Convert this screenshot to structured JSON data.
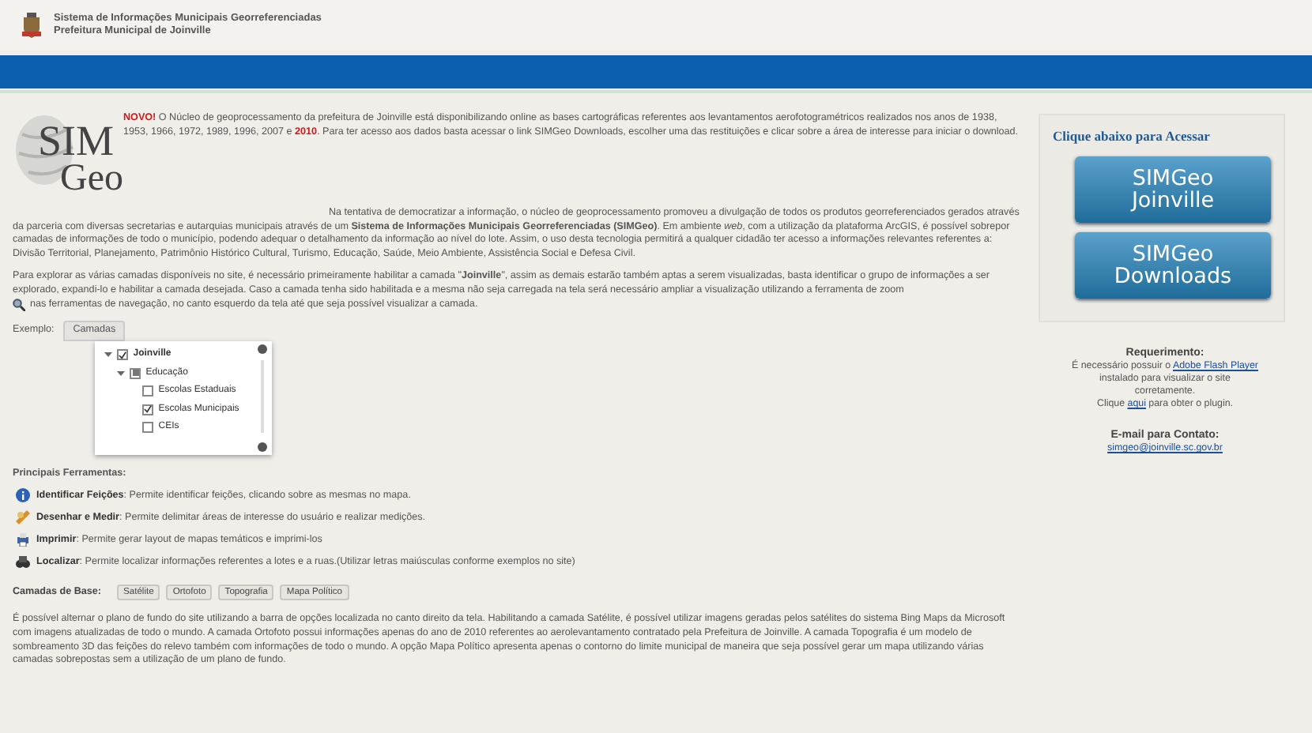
{
  "header": {
    "title": "Sistema de Informações Municipais Georreferenciadas",
    "subtitle": "Prefeitura Municipal de Joinville"
  },
  "logo": {
    "line1": "SIM",
    "line2": "Geo"
  },
  "intro": "**NOVO!** O Núcleo de geoprocessamento da prefeitura de Joinville está disponibilizando online as bases cartográficas referentes aos levantamentos aerofotogramétricos realizados nos anos de 1938, 1953, 1966, 1972, 1989, 1996, 2007 e **2010**. Para ter acesso aos dados basta acessar o link SIMGeo Downloads, escolher uma das restituições e clicar sobre a área de interesse para iniciar o download.",
  "paragraph": "Na tentativa de democratizar a informação, o núcleo de geoprocessamento promoveu a divulgação de todos os produtos georreferenciados gerados através da parceria com diversas secretarias e autarquias municipais através de um **Sistema de Informações Municipais Georreferenciadas (SIMGeo)**. Em ambiente *web*, com a utilização da plataforma ArcGIS, é possível sobrepor camadas de informações de todo o município, podendo adequar o detalhamento da informação ao nível do lote. Assim, o uso desta tecnologia permitirá a qualquer cidadão ter acesso a informações relevantes referentes a: Divisão Territorial, Planejamento, Patrimônio Histórico Cultural, Turismo, Educação, Saúde, Meio Ambiente, Assistência Social e Defesa Civil.",
  "explore": {
    "before": "Para explorar as várias camadas disponíveis no site, é necessário primeiramente habilitar a camada \"**Joinville**\", assim as demais estarão também aptas a serem visualizadas, basta identificar o grupo de informações a ser explorado, expandi-lo e habilitar a camada desejada. Caso a camada tenha sido habilitada e a mesma não seja carregada na tela será necessário ampliar a visualização utilizando a ferramenta de zoom",
    "after": "nas ferramentas de navegação, no canto esquerdo da tela até que seja possível visualizar a camada."
  },
  "example": {
    "label": "Exemplo:",
    "tab": "Camadas",
    "tree": [
      {
        "label": "Joinville",
        "checked": true,
        "expanded": true,
        "children": [
          {
            "label": "Educação",
            "checked": false,
            "mixed": true,
            "expanded": true,
            "children": [
              {
                "label": "Escolas Estaduais",
                "checked": false
              },
              {
                "label": "Escolas Municipais",
                "checked": true
              },
              {
                "label": "CEIs",
                "checked": false
              }
            ]
          }
        ]
      }
    ]
  },
  "tools": {
    "title": "Principais Ferramentas:",
    "items": [
      {
        "kind": "info",
        "text": "**Identificar Feições**: Permite identificar feições, clicando sobre as mesmas no mapa."
      },
      {
        "kind": "draw",
        "text": "**Desenhar e Medir**: Permite delimitar áreas de interesse do usuário e realizar medições."
      },
      {
        "kind": "print",
        "text": "**Imprimir**: Permite gerar layout de mapas temáticos e imprimi-los"
      },
      {
        "kind": "find",
        "text": "**Localizar**: Permite localizar informações referentes a lotes e a ruas.(Utilizar letras maiúsculas conforme exemplos no site)"
      }
    ]
  },
  "base_layers": {
    "label": "Camadas de Base:",
    "buttons": [
      "Satélite",
      "Ortofoto",
      "Topografia",
      "Mapa Político"
    ],
    "text": "É possível alternar o plano de fundo do site utilizando a barra de opções localizada no canto direito da tela. Habilitando a camada Satélite, é possível utilizar imagens geradas pelos satélites do sistema Bing Maps da Microsoft com imagens atualizadas de todo o mundo. A camada Ortofoto possui informações apenas do ano de 2010 referentes ao aerolevantamento contratado pela Prefeitura de Joinville. A camada Topografia é um modelo de sombreamento 3D das feições do relevo também com informações de todo o mundo. A opção Mapa Político apresenta apenas o contorno do limite municipal de maneira que seja possível gerar um mapa utilizando várias camadas sobrepostas sem a utilização de um plano de fundo."
  },
  "sidebar": {
    "title": "Clique abaixo para Acessar",
    "buttons": [
      "SIMGeo Joinville",
      "SIMGeo Downloads"
    ],
    "requirement": {
      "title": "Requerimento:",
      "before": "É necessário possuir o",
      "link": "Adobe Flash Player",
      "after": "instalado para visualizar o site corretamente.",
      "before2": "Clique",
      "link2": "aqui",
      "after2": "para obter o plugin."
    },
    "contact": {
      "title": "E-mail para Contato:",
      "email": "simgeo@joinville.sc.gov.br"
    }
  }
}
